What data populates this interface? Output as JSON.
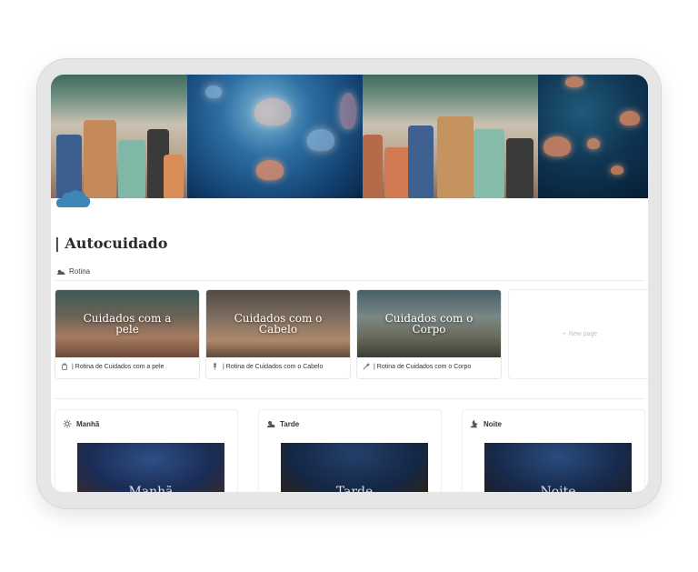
{
  "page": {
    "title": "| Autocuidado",
    "tag": "Rotina"
  },
  "cards": [
    {
      "image_text": "Cuidados com a pele",
      "caption": "| Rotina de Cuidados com a pele",
      "icon": "skincare-bottle-icon"
    },
    {
      "image_text": "Cuidados com o Cabelo",
      "caption": "| Rotina de Cuidados com o Cabelo",
      "icon": "hair-comb-icon"
    },
    {
      "image_text": "Cuidados com o Corpo",
      "caption": "| Rotina de Cuidados com o Corpo",
      "icon": "body-brush-icon"
    }
  ],
  "new_page_label": "New page",
  "boards": [
    {
      "title": "Manhã",
      "image_text": "Manhã",
      "icon": "sun-icon"
    },
    {
      "title": "Tarde",
      "image_text": "Tarde",
      "icon": "sun-cloud-icon"
    },
    {
      "title": "Noite",
      "image_text": "Noite",
      "icon": "moon-cloud-icon"
    }
  ],
  "colors": {
    "page_icon": "#3d86b8",
    "text": "#2a2a2a"
  }
}
